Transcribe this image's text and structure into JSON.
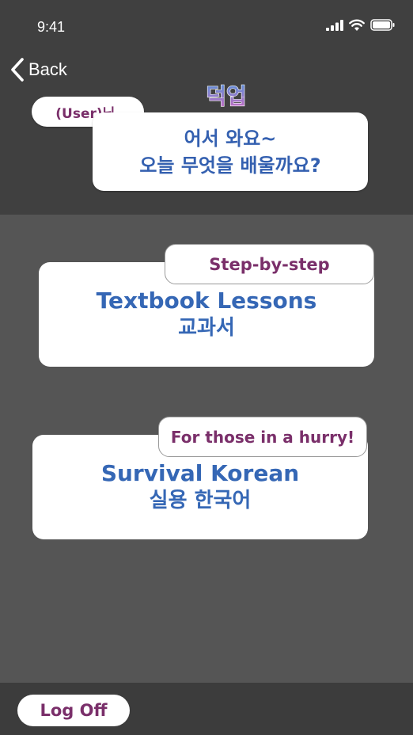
{
  "status_bar": {
    "time": "9:41"
  },
  "nav": {
    "back_label": "Back"
  },
  "greeting": {
    "user_tag": "(User)님,",
    "logo_text": "덕업",
    "line1": "어서 와요~",
    "line2": "오늘 무엇을 배울까요?"
  },
  "menu": {
    "textbook": {
      "tag": "Step-by-step",
      "title": "Textbook Lessons",
      "subtitle": "교과서"
    },
    "survival": {
      "tag": "For those in a hurry!",
      "title": "Survival Korean",
      "subtitle": "실용 한국어"
    }
  },
  "footer": {
    "logoff_label": "Log Off"
  },
  "colors": {
    "header_bg": "#404040",
    "body_bg": "#555555",
    "title_blue": "#3567b5",
    "tag_purple": "#7a2f6a"
  }
}
